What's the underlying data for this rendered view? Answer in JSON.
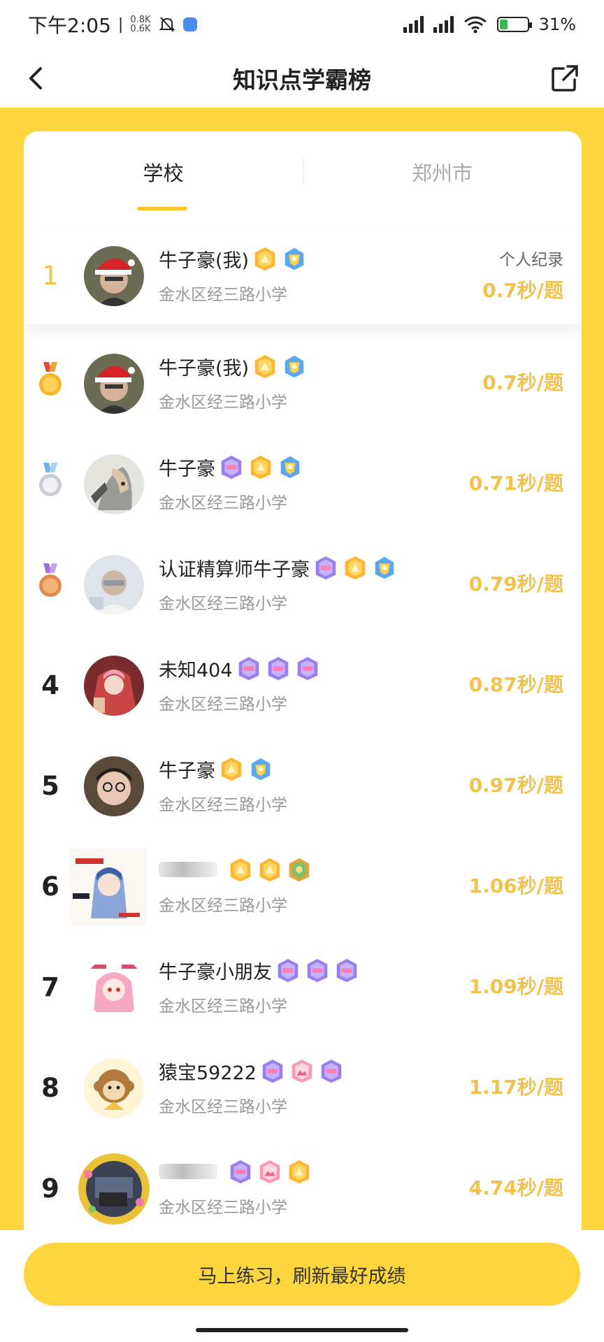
{
  "status": {
    "time": "下午2:05",
    "separator": "|",
    "net_up": "0.8K",
    "net_down": "0.6K",
    "battery": "31%"
  },
  "header": {
    "title": "知识点学霸榜"
  },
  "tabs": [
    {
      "label": "学校"
    },
    {
      "label": "郑州市"
    }
  ],
  "my_row": {
    "rank": "1",
    "name": "牛子豪(我)",
    "school": "金水区经三路小学",
    "record_label": "个人纪录",
    "score": "0.7秒/题"
  },
  "rows": [
    {
      "medal": "gold-medal",
      "name": "牛子豪(我)",
      "school": "金水区经三路小学",
      "score": "0.7秒/题"
    },
    {
      "medal": "silver-medal",
      "name": "牛子豪",
      "school": "金水区经三路小学",
      "score": "0.71秒/题"
    },
    {
      "medal": "bronze-medal",
      "name": "认证精算师牛子豪",
      "school": "金水区经三路小学",
      "score": "0.79秒/题"
    },
    {
      "rank": "4",
      "name": "未知404",
      "school": "金水区经三路小学",
      "score": "0.87秒/题"
    },
    {
      "rank": "5",
      "name": "牛子豪",
      "school": "金水区经三路小学",
      "score": "0.97秒/题"
    },
    {
      "rank": "6",
      "name": "",
      "school": "金水区经三路小学",
      "score": "1.06秒/题"
    },
    {
      "rank": "7",
      "name": "牛子豪小朋友",
      "school": "金水区经三路小学",
      "score": "1.09秒/题"
    },
    {
      "rank": "8",
      "name": "猿宝59222",
      "school": "金水区经三路小学",
      "score": "1.17秒/题"
    },
    {
      "rank": "9",
      "name": "",
      "school": "金水区经三路小学",
      "score": "4.74秒/题"
    }
  ],
  "cta": {
    "label": "马上练习，刷新最好成绩"
  },
  "colors": {
    "accent_yellow": "#ffd53d",
    "score_gold": "#f2c24a",
    "underline": "#ffc62a"
  }
}
